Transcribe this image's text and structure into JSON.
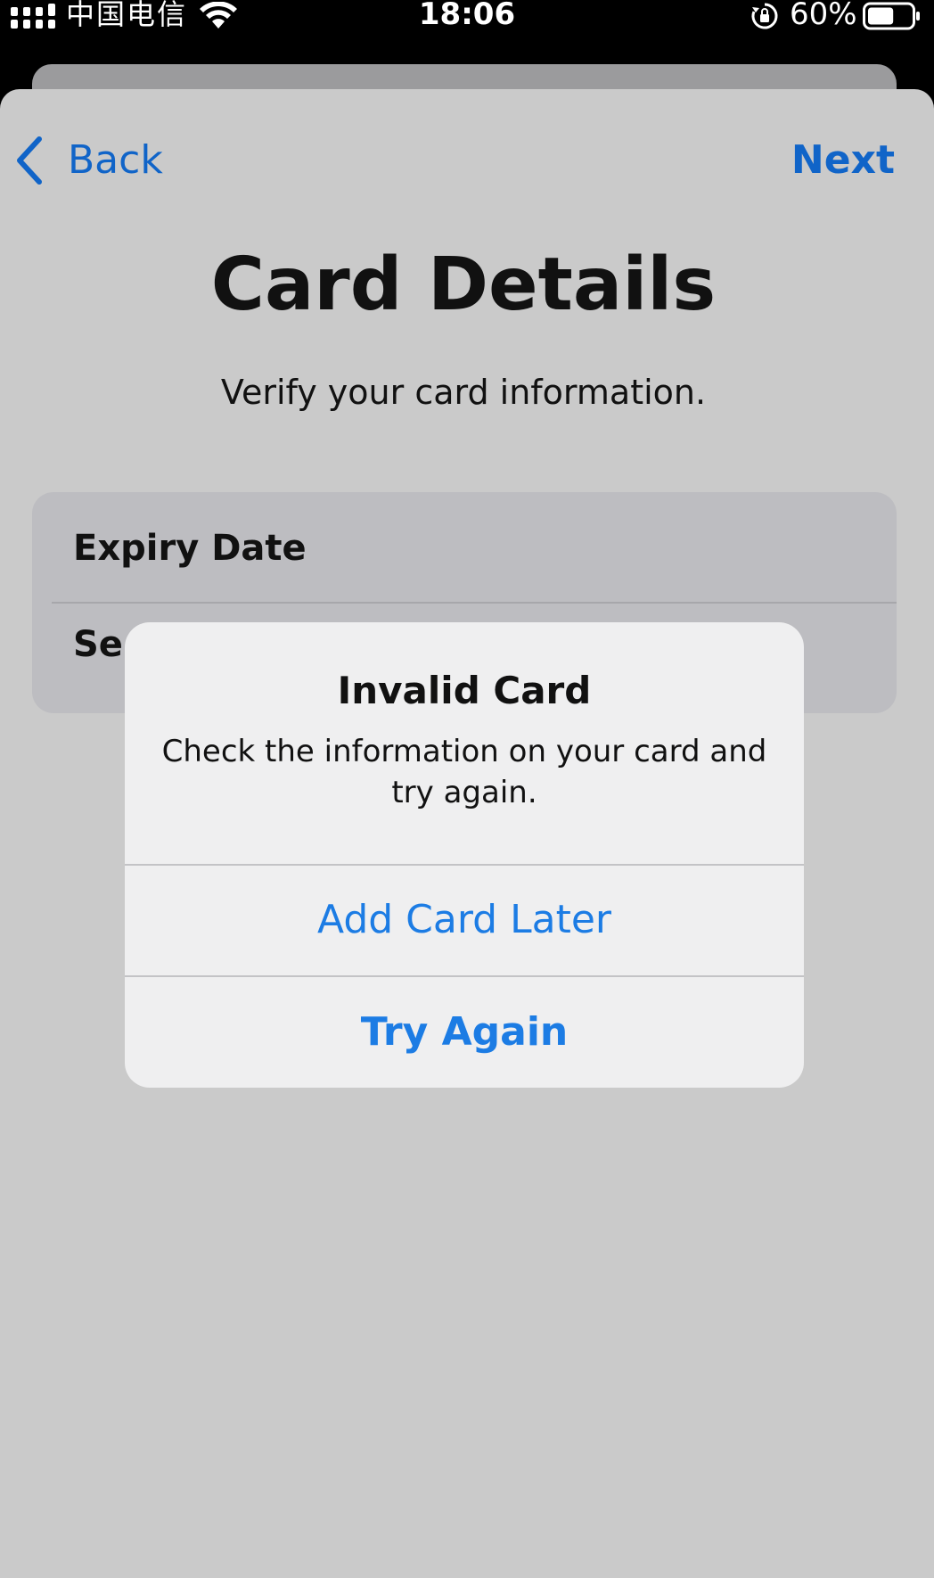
{
  "status_bar": {
    "carrier": "中国电信",
    "time": "18:06",
    "battery_percent": "60%",
    "battery_level": 0.6
  },
  "nav": {
    "back_label": "Back",
    "next_label": "Next"
  },
  "page": {
    "title": "Card Details",
    "subtitle": "Verify your card information."
  },
  "form": {
    "rows": [
      {
        "label": "Expiry Date"
      },
      {
        "label": "Se"
      }
    ]
  },
  "alert": {
    "title": "Invalid Card",
    "message": "Check the information on your card and try again.",
    "buttons": [
      {
        "label": "Add Card Later"
      },
      {
        "label": "Try Again"
      }
    ]
  },
  "colors": {
    "accent": "#1064c8",
    "alert_button": "#1c7ce4",
    "overlay_background": "#cacaca"
  },
  "icons": [
    "cellular-signal-icon",
    "wifi-icon",
    "rotation-lock-icon",
    "battery-icon",
    "chevron-left-icon"
  ]
}
